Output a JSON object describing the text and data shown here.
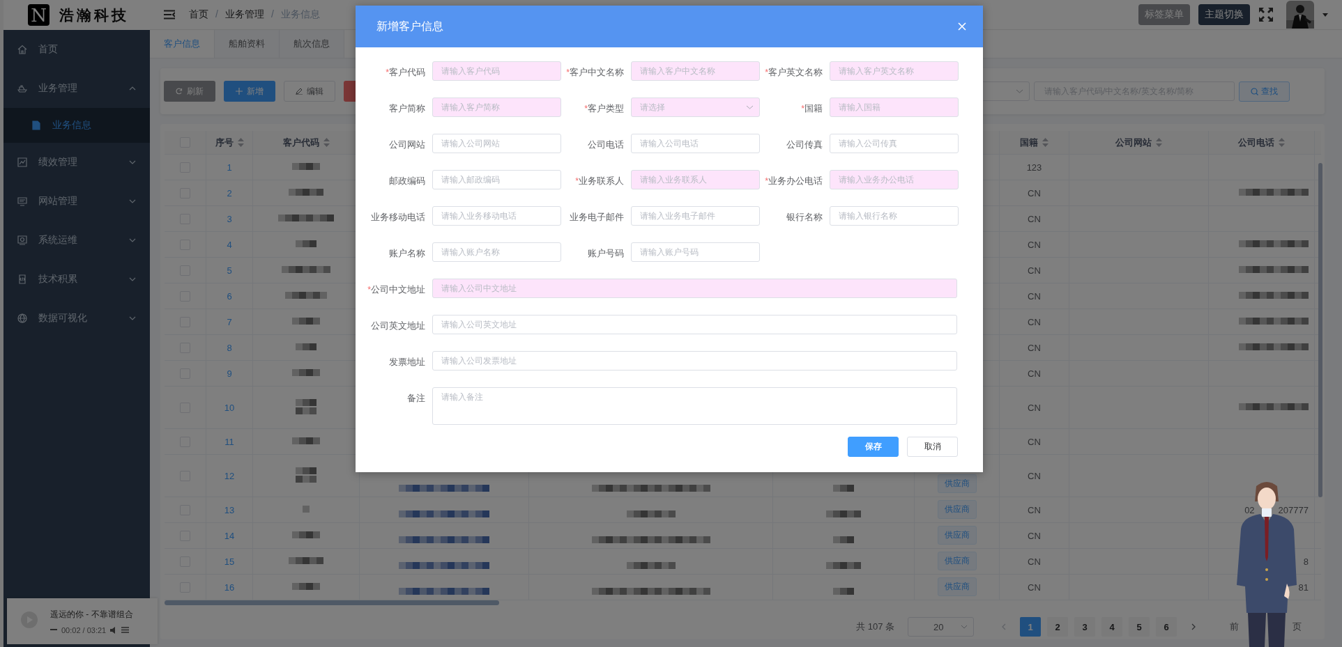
{
  "header": {
    "logo_letter": "N",
    "logo_text": "浩瀚科技",
    "breadcrumb": [
      {
        "label": "首页"
      },
      {
        "label": "业务管理"
      },
      {
        "label": "业务信息"
      }
    ],
    "breadcrumb_separator": "/",
    "buttons": [
      {
        "label": "标签菜单",
        "kind": "secondary"
      },
      {
        "label": "主题切换",
        "kind": "dark"
      }
    ]
  },
  "sidebar": {
    "items": [
      {
        "label": "首页",
        "selected": false
      },
      {
        "label": "业务管理",
        "selected": false,
        "expanded": true,
        "children": [
          {
            "label": "业务信息",
            "selected": true
          }
        ]
      },
      {
        "label": "绩效管理",
        "selected": false,
        "expanded": false
      },
      {
        "label": "网站管理",
        "selected": false,
        "expanded": false
      },
      {
        "label": "系统运维",
        "selected": false,
        "expanded": false
      },
      {
        "label": "技术积累",
        "selected": false,
        "expanded": false
      },
      {
        "label": "数据可视化",
        "selected": false,
        "expanded": false
      }
    ]
  },
  "tabs": [
    {
      "label": "客户信息",
      "selected": true
    },
    {
      "label": "船舶资料",
      "selected": false
    },
    {
      "label": "航次信息",
      "selected": false
    }
  ],
  "toolbar": {
    "buttons": [
      {
        "label": "刷新",
        "kind": "refresh"
      },
      {
        "label": "新增",
        "kind": "add"
      },
      {
        "label": "编辑",
        "kind": "edit"
      },
      {
        "kind": "delete"
      }
    ],
    "search": {
      "placeholder": "请输入客户代码/中文名称/英文名称/简称",
      "button": "查找"
    }
  },
  "table": {
    "all_checked": false,
    "columns": [
      "序号",
      "客户代码",
      "国籍",
      "公司网站",
      "公司电话"
    ],
    "rows": [
      {
        "no": "1",
        "checked": false,
        "nationality": "123"
      },
      {
        "no": "2",
        "checked": false,
        "nationality": "CN"
      },
      {
        "no": "3",
        "checked": false,
        "nationality": "CN"
      },
      {
        "no": "4",
        "checked": false,
        "nationality": "CN"
      },
      {
        "no": "5",
        "checked": false,
        "nationality": "CN"
      },
      {
        "no": "6",
        "checked": false,
        "nationality": "CN"
      },
      {
        "no": "7",
        "checked": false,
        "nationality": "CN"
      },
      {
        "no": "8",
        "checked": false,
        "nationality": "CN"
      },
      {
        "no": "9",
        "checked": false,
        "nationality": "CN"
      },
      {
        "no": "10",
        "checked": false,
        "nationality": "CN"
      },
      {
        "no": "11",
        "checked": false,
        "nationality": "CN"
      },
      {
        "no": "12",
        "checked": false,
        "customer_type": "供应商",
        "nationality": "CN"
      },
      {
        "no": "13",
        "checked": false,
        "customer_type": "供应商",
        "nationality": "CN",
        "phone": [
          "02",
          "207777"
        ]
      },
      {
        "no": "14",
        "checked": false,
        "customer_type": "供应商",
        "nationality": "CN"
      },
      {
        "no": "15",
        "checked": false,
        "customer_type": "供应商",
        "nationality": "CN",
        "phone": [
          "8"
        ]
      },
      {
        "no": "16",
        "checked": false,
        "customer_type": "供应商",
        "nationality": "CN",
        "phone": [
          "81"
        ]
      }
    ]
  },
  "pagination": {
    "total": "共 107 条",
    "page_size": "20",
    "pages": [
      {
        "label": "1",
        "selected": true
      },
      {
        "label": "2",
        "selected": false
      },
      {
        "label": "3",
        "selected": false
      },
      {
        "label": "4",
        "selected": false
      },
      {
        "label": "5",
        "selected": false
      },
      {
        "label": "6",
        "selected": false
      }
    ],
    "jump_prefix": "前",
    "jump_suffix": "页"
  },
  "player": {
    "title": "遥远的你 - 不靠谱组合",
    "time": "00:02 / 03:21"
  },
  "modal": {
    "title": "新增客户信息",
    "required_mark": "*",
    "fields": [
      {
        "label": "客户代码",
        "placeholder": "请输入客户代码",
        "required": true,
        "highlighted": true,
        "kind": "input"
      },
      {
        "label": "客户中文名称",
        "placeholder": "请输入客户中文名称",
        "required": true,
        "highlighted": true,
        "kind": "input"
      },
      {
        "label": "客户英文名称",
        "placeholder": "请输入客户英文名称",
        "required": true,
        "highlighted": true,
        "kind": "input"
      },
      {
        "label": "客户简称",
        "placeholder": "请输入客户简称",
        "required": false,
        "highlighted": true,
        "kind": "input"
      },
      {
        "label": "客户类型",
        "placeholder": "请选择",
        "required": true,
        "highlighted": true,
        "kind": "select"
      },
      {
        "label": "国籍",
        "placeholder": "请输入国籍",
        "required": true,
        "highlighted": true,
        "kind": "input"
      },
      {
        "label": "公司网站",
        "placeholder": "请输入公司网站",
        "required": false,
        "highlighted": false,
        "kind": "input"
      },
      {
        "label": "公司电话",
        "placeholder": "请输入公司电话",
        "required": false,
        "highlighted": false,
        "kind": "input"
      },
      {
        "label": "公司传真",
        "placeholder": "请输入公司传真",
        "required": false,
        "highlighted": false,
        "kind": "input"
      },
      {
        "label": "邮政编码",
        "placeholder": "请输入邮政编码",
        "required": false,
        "highlighted": false,
        "kind": "input"
      },
      {
        "label": "业务联系人",
        "placeholder": "请输入业务联系人",
        "required": true,
        "highlighted": true,
        "kind": "input"
      },
      {
        "label": "业务办公电话",
        "placeholder": "请输入业务办公电话",
        "required": true,
        "highlighted": true,
        "kind": "input"
      },
      {
        "label": "业务移动电话",
        "placeholder": "请输入业务移动电话",
        "required": false,
        "highlighted": false,
        "kind": "input"
      },
      {
        "label": "业务电子邮件",
        "placeholder": "请输入业务电子邮件",
        "required": false,
        "highlighted": false,
        "kind": "input"
      },
      {
        "label": "银行名称",
        "placeholder": "请输入银行名称",
        "required": false,
        "highlighted": false,
        "kind": "input"
      },
      {
        "label": "账户名称",
        "placeholder": "请输入账户名称",
        "required": false,
        "highlighted": false,
        "kind": "input"
      },
      {
        "label": "账户号码",
        "placeholder": "请输入账户号码",
        "required": false,
        "highlighted": false,
        "kind": "input"
      },
      {
        "label": "公司中文地址",
        "placeholder": "请输入公司中文地址",
        "required": true,
        "highlighted": true,
        "kind": "wide"
      },
      {
        "label": "公司英文地址",
        "placeholder": "请输入公司英文地址",
        "required": false,
        "highlighted": false,
        "kind": "wide"
      },
      {
        "label": "发票地址",
        "placeholder": "请输入公司发票地址",
        "required": false,
        "highlighted": false,
        "kind": "wide"
      },
      {
        "label": "备注",
        "placeholder": "请输入备注",
        "required": false,
        "highlighted": false,
        "kind": "textarea"
      }
    ],
    "buttons": [
      {
        "label": "保存",
        "kind": "primary"
      },
      {
        "label": "取消",
        "kind": "default"
      }
    ]
  }
}
